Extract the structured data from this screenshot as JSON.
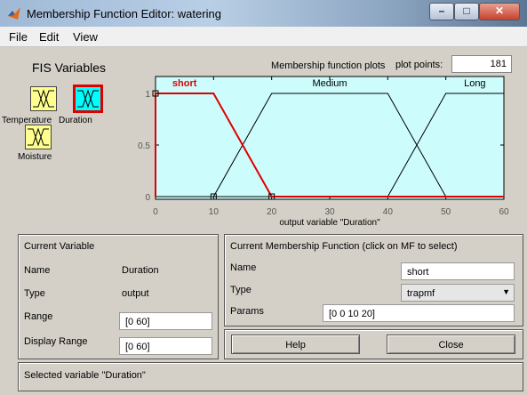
{
  "window": {
    "title": "Membership Function Editor: watering"
  },
  "menu": [
    "File",
    "Edit",
    "View"
  ],
  "fis": {
    "heading": "FIS Variables",
    "variables": [
      {
        "name": "Temperature",
        "selected": false
      },
      {
        "name": "Duration",
        "selected": true
      },
      {
        "name": "Moisture",
        "selected": false
      }
    ]
  },
  "plot": {
    "title": "Membership function plots",
    "plot_points_label": "plot points:",
    "plot_points": "181"
  },
  "chart_data": {
    "type": "line",
    "xlabel": "output variable \"Duration\"",
    "xlim": [
      0,
      60
    ],
    "ylim": [
      0,
      1
    ],
    "xticks": [
      "0",
      "10",
      "20",
      "30",
      "40",
      "50",
      "60"
    ],
    "yticks": [
      "0",
      "0.5",
      "1"
    ],
    "series": [
      {
        "name": "short",
        "params": [
          0,
          0,
          10,
          20
        ],
        "color": "#e00000",
        "selected": true
      },
      {
        "name": "Medium",
        "params": [
          10,
          20,
          40,
          50
        ],
        "color": "#000000",
        "selected": false
      },
      {
        "name": "Long",
        "params": [
          40,
          50,
          60,
          60
        ],
        "color": "#000000",
        "selected": false
      }
    ]
  },
  "current_variable": {
    "heading": "Current Variable",
    "name_label": "Name",
    "name": "Duration",
    "type_label": "Type",
    "type": "output",
    "range_label": "Range",
    "range": "[0 60]",
    "display_range_label": "Display Range",
    "display_range": "[0 60]"
  },
  "current_mf": {
    "heading": "Current Membership Function (click on MF to select)",
    "name_label": "Name",
    "name": "short",
    "type_label": "Type",
    "type": "trapmf",
    "params_label": "Params",
    "params": "[0 0 10 20]"
  },
  "buttons": {
    "help": "Help",
    "close": "Close"
  },
  "status": "Selected variable \"Duration\"",
  "colors": {
    "plot_bg": "#ccfcfc",
    "selected_mf": "#e00000",
    "var_box": "#ffff90",
    "selected_border": "#e00000"
  }
}
